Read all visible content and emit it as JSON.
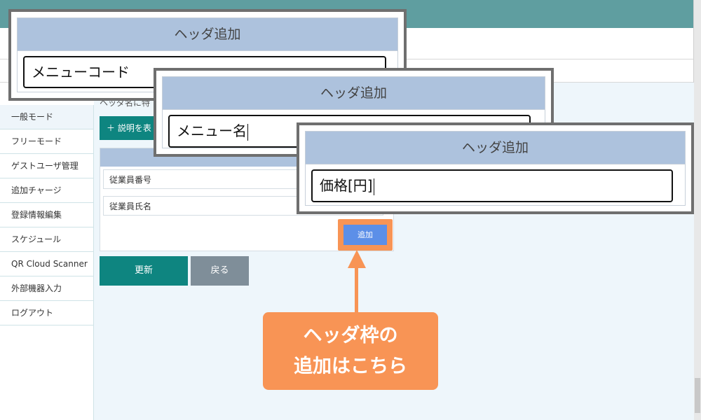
{
  "sidebar": {
    "items": [
      {
        "label": "一般モード"
      },
      {
        "label": "フリーモード"
      },
      {
        "label": "ゲストユーザ管理"
      },
      {
        "label": "追加チャージ"
      },
      {
        "label": "登録情報編集"
      },
      {
        "label": "スケジュール"
      },
      {
        "label": "QR Cloud Scanner"
      },
      {
        "label": "外部機器入力"
      },
      {
        "label": "ログアウト"
      }
    ]
  },
  "main": {
    "intro_text": "ヘッダ名に特",
    "help_button": "＋ 説明を表",
    "rows": [
      "従業員番号",
      "従業員氏名"
    ],
    "add_button": "追加",
    "update_button": "更新",
    "back_button": "戻る"
  },
  "dialogs": [
    {
      "title": "ヘッダ追加",
      "value": "メニューコード"
    },
    {
      "title": "ヘッダ追加",
      "value": "メニュー名"
    },
    {
      "title": "ヘッダ追加",
      "value": "価格[円]"
    }
  ],
  "callout": {
    "line1": "ヘッダ枠の",
    "line2": "追加はこちら"
  },
  "colors": {
    "topbar": "#5f9ea0",
    "accent_teal": "#0e8580",
    "dialog_header": "#adc2dd",
    "callout_orange": "#f89455",
    "add_button_blue": "#5c8fe8"
  }
}
